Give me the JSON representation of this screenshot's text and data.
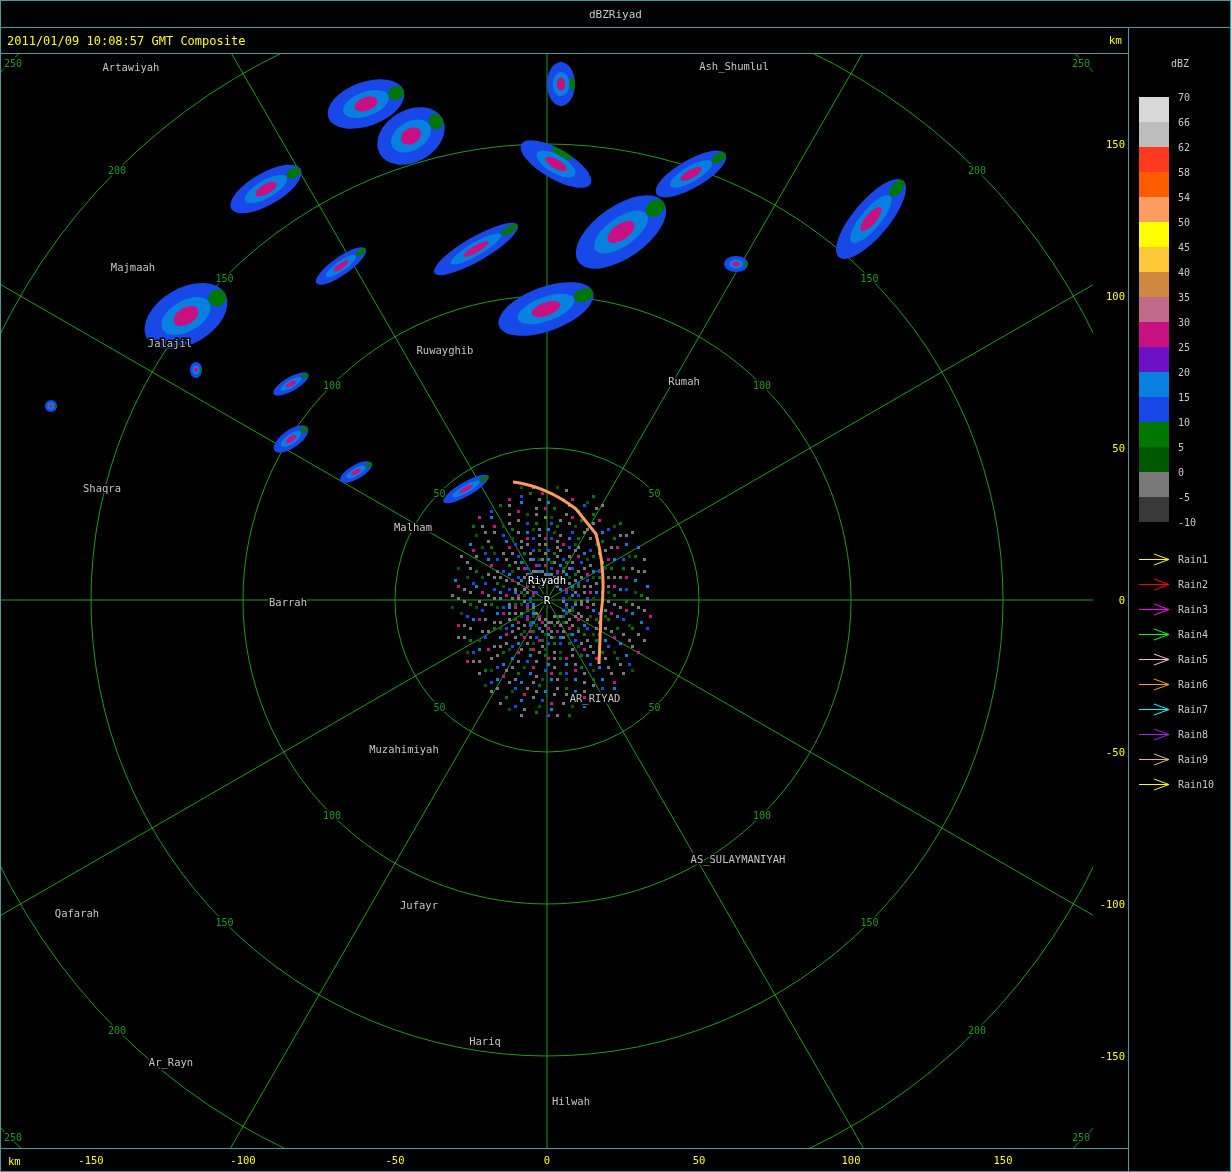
{
  "window": {
    "title": "dBZRiyad"
  },
  "header": {
    "timestamp": "2011/01/09 10:08:57 GMT Composite",
    "unit": "km"
  },
  "map": {
    "site_marker": "R",
    "rings": [
      {
        "labels": [
          "50",
          "50",
          "50",
          "50"
        ]
      },
      {
        "labels": [
          "100",
          "100",
          "100",
          "100"
        ]
      },
      {
        "labels": [
          "150",
          "150",
          "150",
          "150"
        ]
      },
      {
        "labels": [
          "200",
          "200",
          "200",
          "200"
        ]
      },
      {
        "labels": [
          "250",
          "250",
          "250",
          "250"
        ]
      }
    ],
    "places": [
      {
        "name": "Artawiyah",
        "kind": "town"
      },
      {
        "name": "Ash_Shumlul",
        "kind": "town"
      },
      {
        "name": "Majmaah",
        "kind": "town"
      },
      {
        "name": "Jalajil",
        "kind": "town"
      },
      {
        "name": "Ruwayghib",
        "kind": "town"
      },
      {
        "name": "Rumah",
        "kind": "town"
      },
      {
        "name": "Shaqra",
        "kind": "town"
      },
      {
        "name": "Malham",
        "kind": "town"
      },
      {
        "name": "Riyadh",
        "kind": "radar_site"
      },
      {
        "name": "Barrah",
        "kind": "town"
      },
      {
        "name": "AR_RIYAD",
        "kind": "town"
      },
      {
        "name": "Muzahimiyah",
        "kind": "town"
      },
      {
        "name": "AS_SULAYMANIYAH",
        "kind": "town"
      },
      {
        "name": "Qafarah",
        "kind": "town"
      },
      {
        "name": "Jufayr",
        "kind": "town"
      },
      {
        "name": "Hariq",
        "kind": "town"
      },
      {
        "name": "Ar_Rayn",
        "kind": "town"
      },
      {
        "name": "Hilwah",
        "kind": "town"
      }
    ]
  },
  "y_axis": {
    "labels": [
      "150",
      "100",
      "50",
      "0",
      "-50",
      "-100",
      "-150"
    ]
  },
  "x_axis": {
    "unit": "km",
    "labels": [
      "-150",
      "-100",
      "-50",
      "0",
      "50",
      "100",
      "150"
    ]
  },
  "legend": {
    "title": "dBZ",
    "ticks": [
      "70",
      "66",
      "62",
      "58",
      "54",
      "50",
      "45",
      "40",
      "35",
      "30",
      "25",
      "20",
      "15",
      "10",
      "5",
      "0",
      "-5",
      "-10"
    ],
    "bands": [
      {
        "color": "#d8d8d8"
      },
      {
        "color": "#bebebe"
      },
      {
        "color": "#ff3820"
      },
      {
        "color": "#ff5c00"
      },
      {
        "color": "#ff9c60"
      },
      {
        "color": "#ffff00"
      },
      {
        "color": "#fcc838"
      },
      {
        "color": "#d08840"
      },
      {
        "color": "#c06888"
      },
      {
        "color": "#c81080"
      },
      {
        "color": "#6c10c8"
      },
      {
        "color": "#0880e0"
      },
      {
        "color": "#1848e8"
      },
      {
        "color": "#007800"
      },
      {
        "color": "#005800"
      },
      {
        "color": "#787878"
      },
      {
        "color": "#383838"
      }
    ]
  },
  "rain_tracks": [
    {
      "label": "Rain1",
      "color": "#ffff00"
    },
    {
      "label": "Rain2",
      "color": "#ff0000"
    },
    {
      "label": "Rain3",
      "color": "#ff00ff"
    },
    {
      "label": "Rain4",
      "color": "#00ff00"
    },
    {
      "label": "Rain5",
      "color": "#ffc0c8"
    },
    {
      "label": "Rain6",
      "color": "#ffa000"
    },
    {
      "label": "Rain7",
      "color": "#00ffff"
    },
    {
      "label": "Rain8",
      "color": "#a020f0"
    },
    {
      "label": "Rain9",
      "color": "#e0b890"
    },
    {
      "label": "Rain10",
      "color": "#ffff00"
    }
  ]
}
